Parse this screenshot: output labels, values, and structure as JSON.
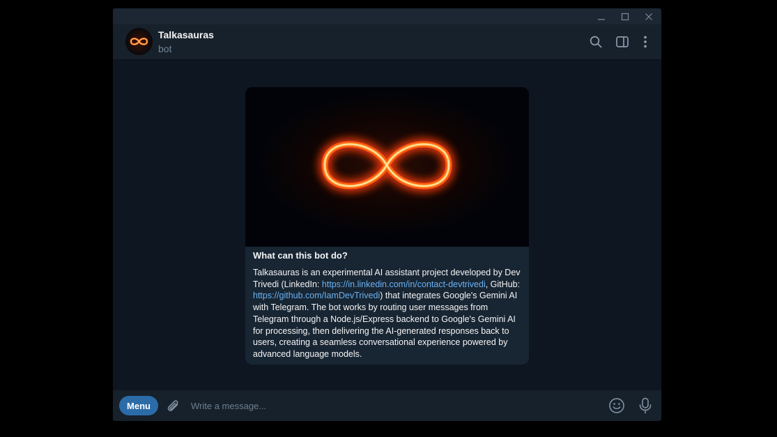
{
  "header": {
    "chat_name": "Talkasauras",
    "chat_status": "bot"
  },
  "intro_card": {
    "title": "What can this bot do?",
    "text_1": "Talkasauras is an experimental AI assistant project developed by Dev Trivedi (LinkedIn: ",
    "link_linkedin": "https://in.linkedin.com/in/contact-devtrivedi",
    "text_2": ", GitHub: ",
    "link_github": "https://github.com/IamDevTrivedi",
    "text_3": ") that integrates Google's Gemini AI with Telegram. The bot works by routing user messages from Telegram through a Node.js/Express backend to Google's Gemini AI for processing, then delivering the AI-generated responses back to users, creating a seamless conversational experience powered by advanced language models."
  },
  "composer": {
    "menu_label": "Menu",
    "placeholder": "Write a message..."
  },
  "icons": {
    "window_controls": [
      "minimize-icon",
      "maximize-icon",
      "close-icon"
    ],
    "header": [
      "search-icon",
      "sidebar-toggle-icon",
      "more-vertical-icon"
    ],
    "composer": [
      "attach-icon",
      "emoji-icon",
      "microphone-icon"
    ],
    "avatar": "infinity-fire-logo"
  },
  "colors": {
    "accent": "#2b6ca8",
    "link": "#6ab3f3",
    "background": "#0e1621",
    "panel": "#17212b",
    "bubble": "#182533",
    "muted_text": "#708499"
  }
}
